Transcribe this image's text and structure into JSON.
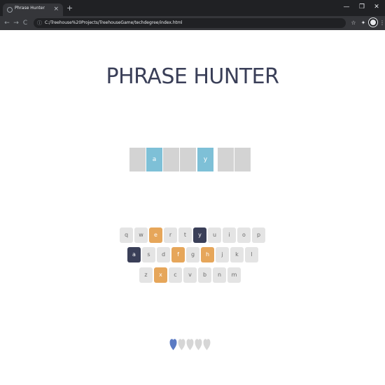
{
  "browser": {
    "tab_title": "Phrase Hunter",
    "tab_close": "×",
    "new_tab": "+",
    "window_controls": [
      "—",
      "❐",
      "✕"
    ],
    "url": "C:/Treehouse%20Projects/TreehouseGame/techdegree/index.html",
    "info_icon": "ⓘ",
    "nav": {
      "back": "←",
      "forward": "→",
      "reload": "C"
    },
    "toolbar_icons": [
      "star-icon",
      "extensions-icon",
      "profile-avatar",
      "menu-icon"
    ]
  },
  "game": {
    "title": "PHRASE HUNTER",
    "phrase": [
      {
        "letter": "",
        "shown": false
      },
      {
        "letter": "a",
        "shown": true
      },
      {
        "letter": "",
        "shown": false
      },
      {
        "letter": "",
        "shown": false
      },
      {
        "letter": "y",
        "shown": true
      },
      {
        "letter": "",
        "shown": false
      },
      {
        "letter": "",
        "shown": false
      }
    ],
    "keyboard": [
      [
        {
          "key": "q",
          "state": "default"
        },
        {
          "key": "w",
          "state": "default"
        },
        {
          "key": "e",
          "state": "wrong"
        },
        {
          "key": "r",
          "state": "default"
        },
        {
          "key": "t",
          "state": "default"
        },
        {
          "key": "y",
          "state": "chosen"
        },
        {
          "key": "u",
          "state": "default"
        },
        {
          "key": "i",
          "state": "default"
        },
        {
          "key": "o",
          "state": "default"
        },
        {
          "key": "p",
          "state": "default"
        }
      ],
      [
        {
          "key": "a",
          "state": "chosen"
        },
        {
          "key": "s",
          "state": "default"
        },
        {
          "key": "d",
          "state": "default"
        },
        {
          "key": "f",
          "state": "wrong"
        },
        {
          "key": "g",
          "state": "default"
        },
        {
          "key": "h",
          "state": "wrong"
        },
        {
          "key": "j",
          "state": "default"
        },
        {
          "key": "k",
          "state": "default"
        },
        {
          "key": "l",
          "state": "default"
        }
      ],
      [
        {
          "key": "z",
          "state": "default"
        },
        {
          "key": "x",
          "state": "wrong"
        },
        {
          "key": "c",
          "state": "default"
        },
        {
          "key": "v",
          "state": "default"
        },
        {
          "key": "b",
          "state": "default"
        },
        {
          "key": "n",
          "state": "default"
        },
        {
          "key": "m",
          "state": "default"
        }
      ]
    ],
    "lives": [
      {
        "state": "live"
      },
      {
        "state": "lost"
      },
      {
        "state": "lost"
      },
      {
        "state": "lost"
      },
      {
        "state": "lost"
      }
    ],
    "colors": {
      "live_heart": "#5b7bc4",
      "lost_heart": "#d6d6d6"
    }
  }
}
